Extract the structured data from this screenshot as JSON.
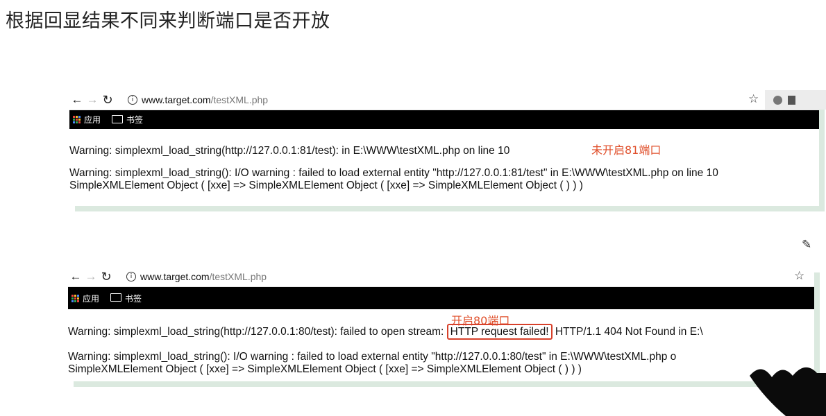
{
  "title": "根据回显结果不同来判断端口是否开放",
  "shot1": {
    "url_host": "www.target.com",
    "url_path": "/testXML.php",
    "bookmarks": {
      "apps": "应用",
      "folder": "书签"
    },
    "annotation": "未开启81端口",
    "lines": [
      "Warning: simplexml_load_string(http://127.0.0.1:81/test): in E:\\WWW\\testXML.php on line 10",
      "Warning: simplexml_load_string(): I/O warning : failed to load external entity \"http://127.0.0.1:81/test\" in E:\\WWW\\testXML.php on line 10",
      "SimpleXMLElement Object ( [xxe] => SimpleXMLElement Object ( [xxe] => SimpleXMLElement Object ( ) ) )"
    ]
  },
  "shot2": {
    "url_host": "www.target.com",
    "url_path": "/testXML.php",
    "bookmarks": {
      "apps": "应用",
      "folder": "书签"
    },
    "annotation": "开启80端口",
    "line1_pre": "Warning: simplexml_load_string(http://127.0.0.1:80/test): failed to open stream:",
    "line1_highlight": "HTTP request failed!",
    "line1_post": "HTTP/1.1 404 Not Found in E:\\",
    "lines": [
      "Warning: simplexml_load_string(): I/O warning : failed to load external entity \"http://127.0.0.1:80/test\" in E:\\WWW\\testXML.php o",
      "SimpleXMLElement Object ( [xxe] => SimpleXMLElement Object ( [xxe] => SimpleXMLElement Object ( ) ) )"
    ]
  },
  "colors": {
    "annotation": "#e0502c",
    "highlight_box": "#d7402a",
    "shadow": "#dbe9df"
  },
  "icons": [
    "back-arrow-icon",
    "forward-arrow-icon",
    "reload-icon",
    "info-icon",
    "star-icon",
    "apps-grid-icon",
    "folder-icon",
    "pencil-icon"
  ]
}
